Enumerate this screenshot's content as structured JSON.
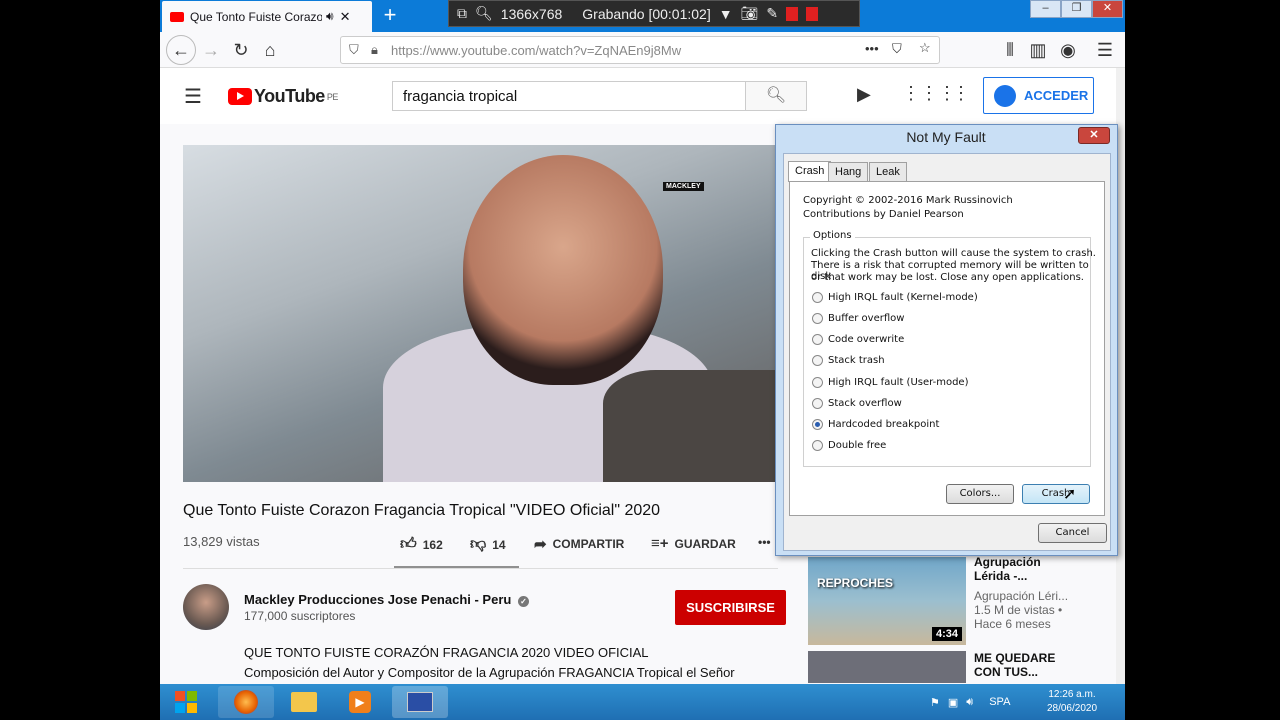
{
  "browser": {
    "tab_title": "Que Tonto Fuiste Corazon F",
    "url": "https://www.youtube.com/watch?v=ZqNAEn9j8Mw"
  },
  "recorder": {
    "resolution": "1366x768",
    "status": "Grabando [00:01:02]"
  },
  "youtube": {
    "logo": "YouTube",
    "country": "PE",
    "search_value": "fragancia tropical",
    "signin_label": "ACCEDER",
    "video_title": "Que Tonto Fuiste Corazon Fragancia Tropical \"VIDEO Oficial\" 2020",
    "views": "13,829 vistas",
    "likes": "162",
    "dislikes": "14",
    "share_label": "COMPARTIR",
    "save_label": "GUARDAR",
    "watermark": "MACKLEY",
    "channel_name": "Mackley Producciones Jose Penachi - Peru",
    "subscribers": "177,000 suscriptores",
    "subscribe_label": "SUSCRIBIRSE",
    "description_line1": "QUE TONTO FUISTE CORAZÓN FRAGANCIA 2020 VIDEO OFICIAL",
    "description_line2": "Composición del Autor y Compositor  de la Agrupación FRAGANCIA Tropical el Señor",
    "related": [
      {
        "thumb_label": "REPROCHES",
        "duration": "4:34",
        "title_line1": "Agrupación",
        "title_line2": "Lérida -...",
        "channel": "Agrupación Léri...",
        "views": "1.5 M de vistas •",
        "age": "Hace 6 meses"
      },
      {
        "title_line1": "ME QUEDARE",
        "title_line2": "CON TUS..."
      }
    ]
  },
  "dialog": {
    "title": "Not My Fault",
    "tabs": [
      "Crash",
      "Hang",
      "Leak"
    ],
    "copyright": "Copyright © 2002-2016 Mark Russinovich",
    "contributions": "Contributions by Daniel Pearson",
    "options_label": "Options",
    "warning_1": "Clicking the Crash button will cause the system to crash.",
    "warning_2": "There is a risk that corrupted memory will be written to disk",
    "warning_3": "or that work may be lost. Close any open applications.",
    "options": [
      "High IRQL fault (Kernel-mode)",
      "Buffer overflow",
      "Code overwrite",
      "Stack trash",
      "High IRQL fault (User-mode)",
      "Stack overflow",
      "Hardcoded breakpoint",
      "Double free"
    ],
    "selected_option": "Hardcoded breakpoint",
    "colors_label": "Colors...",
    "crash_label": "Crash",
    "cancel_label": "Cancel"
  },
  "taskbar": {
    "language": "SPA",
    "time": "12:26 a.m.",
    "date": "28/06/2020"
  }
}
